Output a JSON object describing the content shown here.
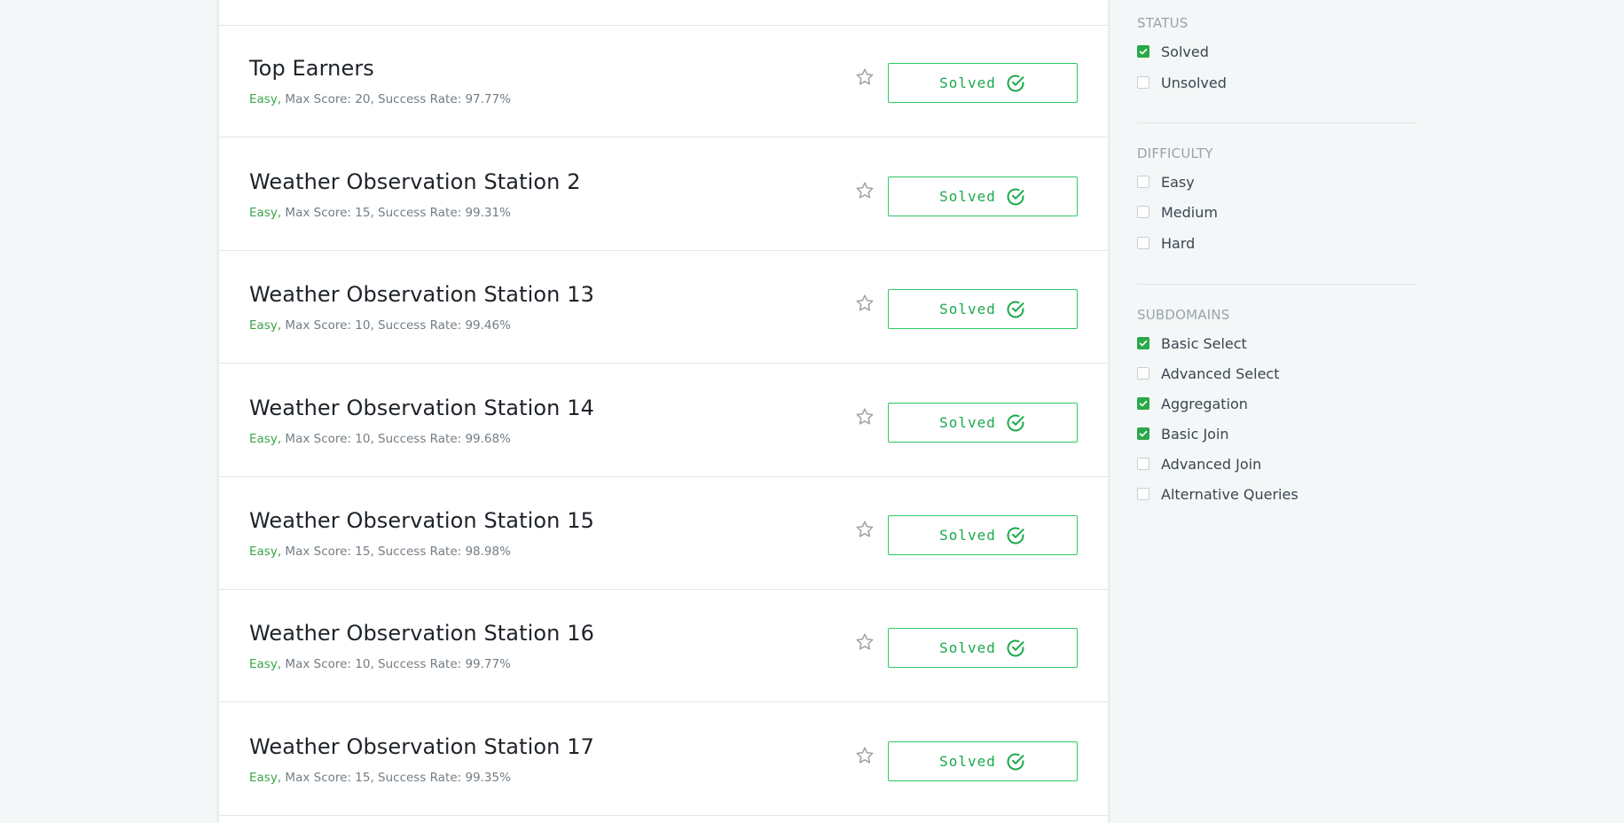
{
  "challenges": [
    {
      "title": "Top Earners",
      "difficulty": "Easy,",
      "meta": "Max Score: 20, Success Rate: 97.77%",
      "status": "Solved"
    },
    {
      "title": "Weather Observation Station 2",
      "difficulty": "Easy,",
      "meta": "Max Score: 15, Success Rate: 99.31%",
      "status": "Solved"
    },
    {
      "title": "Weather Observation Station 13",
      "difficulty": "Easy,",
      "meta": "Max Score: 10, Success Rate: 99.46%",
      "status": "Solved"
    },
    {
      "title": "Weather Observation Station 14",
      "difficulty": "Easy,",
      "meta": "Max Score: 10, Success Rate: 99.68%",
      "status": "Solved"
    },
    {
      "title": "Weather Observation Station 15",
      "difficulty": "Easy,",
      "meta": "Max Score: 15, Success Rate: 98.98%",
      "status": "Solved"
    },
    {
      "title": "Weather Observation Station 16",
      "difficulty": "Easy,",
      "meta": "Max Score: 10, Success Rate: 99.77%",
      "status": "Solved"
    },
    {
      "title": "Weather Observation Station 17",
      "difficulty": "Easy,",
      "meta": "Max Score: 15, Success Rate: 99.35%",
      "status": "Solved"
    }
  ],
  "filters": {
    "status": {
      "title": "STATUS",
      "options": [
        {
          "label": "Solved",
          "checked": true
        },
        {
          "label": "Unsolved",
          "checked": false
        }
      ]
    },
    "difficulty": {
      "title": "DIFFICULTY",
      "options": [
        {
          "label": "Easy",
          "checked": false
        },
        {
          "label": "Medium",
          "checked": false
        },
        {
          "label": "Hard",
          "checked": false
        }
      ]
    },
    "subdomains": {
      "title": "SUBDOMAINS",
      "options": [
        {
          "label": "Basic Select",
          "checked": true
        },
        {
          "label": "Advanced Select",
          "checked": false
        },
        {
          "label": "Aggregation",
          "checked": true
        },
        {
          "label": "Basic Join",
          "checked": true
        },
        {
          "label": "Advanced Join",
          "checked": false
        },
        {
          "label": "Alternative Queries",
          "checked": false
        }
      ]
    }
  },
  "colors": {
    "accent": "#2ec866",
    "easy": "#39a64a",
    "checkbox_on": "#2aa84a",
    "background": "#f3f7f7"
  },
  "icons": {
    "star": "star-icon",
    "check": "check-circle-icon",
    "checkbox_check": "checkmark-icon"
  }
}
